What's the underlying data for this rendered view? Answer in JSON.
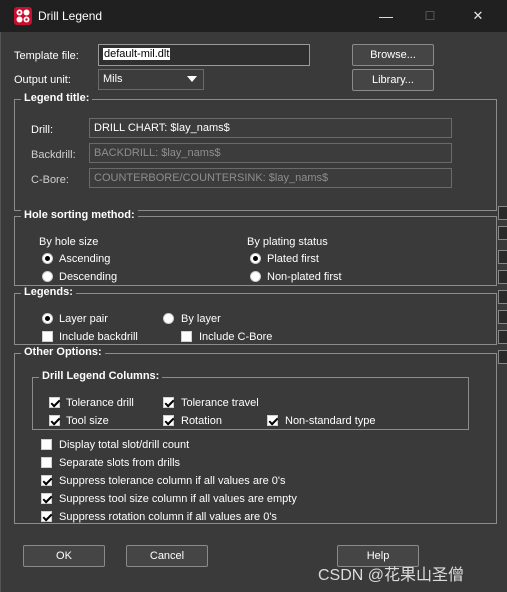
{
  "window": {
    "title": "Drill Legend",
    "minimize": "—",
    "maximize": "☐",
    "close": "✕"
  },
  "template": {
    "label": "Template file:",
    "value": "default-mil.dlt",
    "browse": "Browse..."
  },
  "output": {
    "label": "Output unit:",
    "value": "Mils",
    "library": "Library..."
  },
  "legend_title": {
    "title": "Legend title:",
    "drill_label": "Drill:",
    "drill_value": "DRILL CHART: $lay_nams$",
    "backdrill_label": "Backdrill:",
    "backdrill_value": "BACKDRILL: $lay_nams$",
    "cbore_label": "C-Bore:",
    "cbore_value": "COUNTERBORE/COUNTERSINK: $lay_nams$"
  },
  "hole_sorting": {
    "title": "Hole sorting method:",
    "by_size": "By hole size",
    "ascending": "Ascending",
    "descending": "Descending",
    "by_plating": "By plating status",
    "plated_first": "Plated first",
    "nonplated_first": "Non-plated first"
  },
  "legends": {
    "title": "Legends:",
    "layer_pair": "Layer pair",
    "by_layer": "By layer",
    "include_backdrill": "Include backdrill",
    "include_cbore": "Include C-Bore"
  },
  "other": {
    "title": "Other Options:",
    "columns_title": "Drill Legend Columns:",
    "tolerance_drill": "Tolerance drill",
    "tolerance_travel": "Tolerance travel",
    "tool_size": "Tool size",
    "rotation": "Rotation",
    "nonstandard_type": "Non-standard type",
    "display_total": "Display total slot/drill count",
    "separate_slots": "Separate slots from drills",
    "suppress_tolerance": "Suppress tolerance column if all values are 0's",
    "suppress_tool_size": "Suppress tool size column if all values are empty",
    "suppress_rotation": "Suppress rotation column if all values are 0's"
  },
  "buttons": {
    "ok": "OK",
    "cancel": "Cancel",
    "help": "Help"
  },
  "watermark": "CSDN @花果山圣僧"
}
